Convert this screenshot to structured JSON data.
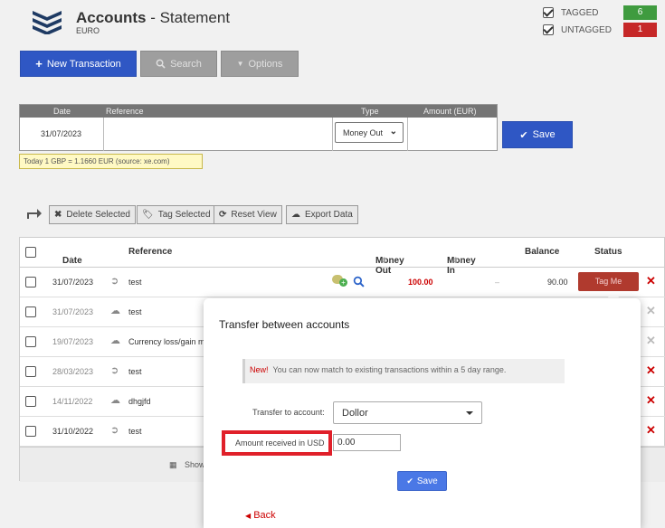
{
  "header": {
    "title_bold": "Accounts",
    "title_rest": " - Statement",
    "subtitle": "EURO",
    "tagged_label": "TAGGED",
    "tagged_count": "6",
    "untagged_label": "UNTAGGED",
    "untagged_count": "1",
    "tagged_color": "#3f9b3f",
    "untagged_color": "#c62828"
  },
  "actions": {
    "new_transaction": "New Transaction",
    "search": "Search",
    "options": "Options"
  },
  "entry": {
    "headers": {
      "date": "Date",
      "reference": "Reference",
      "type": "Type",
      "amount": "Amount (EUR)"
    },
    "date_value": "31/07/2023",
    "type_value": "Money Out",
    "save": "Save",
    "rate_note": "Today 1 GBP = 1.1660 EUR (source: xe.com)"
  },
  "toolbar": {
    "delete": "Delete Selected",
    "tag": "Tag Selected",
    "reset": "Reset View",
    "export": "Export Data"
  },
  "table": {
    "headers": {
      "date": "Date",
      "reference": "Reference",
      "money_out": "Money Out",
      "money_in": "Money In",
      "balance": "Balance",
      "status": "Status"
    },
    "rows": [
      {
        "date": "31/07/2023",
        "reference": "test",
        "money_out": "100.00",
        "money_in": "–",
        "balance": "90.00",
        "status": "Tag Me"
      },
      {
        "date": "31/07/2023",
        "reference": "test"
      },
      {
        "date": "19/07/2023",
        "reference": "Currency loss/gain m"
      },
      {
        "date": "28/03/2023",
        "reference": "test"
      },
      {
        "date": "14/11/2022",
        "reference": "dhgjfd"
      },
      {
        "date": "31/10/2022",
        "reference": "test"
      }
    ],
    "footer_text": "Show"
  },
  "modal": {
    "title": "Transfer between accounts",
    "new_tag": "New!",
    "banner": "You can now match to existing transactions within a 5 day range.",
    "transfer_label": "Transfer to account:",
    "transfer_value": "Dollor",
    "amount_label": "Amount received in USD",
    "amount_value": "0.00",
    "save": "Save",
    "back": "Back"
  }
}
